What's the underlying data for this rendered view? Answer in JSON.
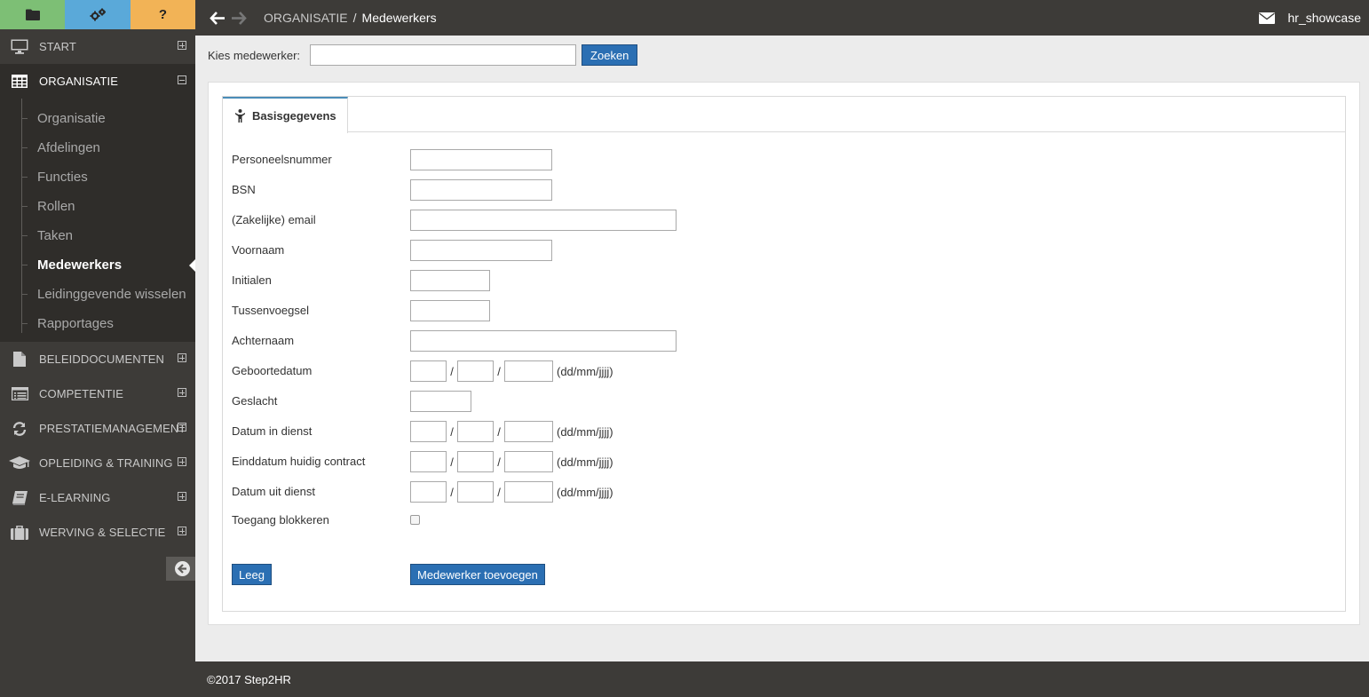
{
  "sidebar": {
    "tabs": [
      {
        "icon": "folder-icon"
      },
      {
        "icon": "gears-icon"
      },
      {
        "icon": "help-icon",
        "label": "?"
      }
    ],
    "sections": {
      "start": {
        "label": "START",
        "icon": "monitor-icon",
        "toggle": "expand"
      },
      "organisatie": {
        "label": "ORGANISATIE",
        "icon": "grid-icon",
        "toggle": "collapse"
      },
      "beleid": {
        "label": "BELEIDDOCUMENTEN",
        "icon": "document-icon",
        "toggle": "expand"
      },
      "competentie": {
        "label": "COMPETENTIE",
        "icon": "list-icon",
        "toggle": "expand"
      },
      "prestatie": {
        "label": "PRESTATIEMANAGEMENT",
        "icon": "refresh-icon",
        "toggle": "expand"
      },
      "opleiding": {
        "label": "OPLEIDING & TRAINING",
        "icon": "graduation-cap-icon",
        "toggle": "expand"
      },
      "elearning": {
        "label": "E-LEARNING",
        "icon": "book-icon",
        "toggle": "expand"
      },
      "werving": {
        "label": "WERVING & SELECTIE",
        "icon": "briefcase-icon",
        "toggle": "expand"
      }
    },
    "sub_items": [
      {
        "label": "Organisatie"
      },
      {
        "label": "Afdelingen"
      },
      {
        "label": "Functies"
      },
      {
        "label": "Rollen"
      },
      {
        "label": "Taken"
      },
      {
        "label": "Medewerkers",
        "active": true
      },
      {
        "label": "Leidinggevende wisselen"
      },
      {
        "label": "Rapportages"
      }
    ],
    "collapse_icon": "arrow-circle-left-icon"
  },
  "topbar": {
    "breadcrumb_parent": "ORGANISATIE",
    "breadcrumb_separator": "/",
    "breadcrumb_current": "Medewerkers",
    "user": "hr_showcase"
  },
  "search": {
    "label": "Kies medewerker:",
    "value": "",
    "button": "Zoeken"
  },
  "form": {
    "tab_label": "Basisgegevens",
    "fields": {
      "personeelsnummer": "Personeelsnummer",
      "bsn": "BSN",
      "email": "(Zakelijke) email",
      "voornaam": "Voornaam",
      "initialen": "Initialen",
      "tussenvoegsel": "Tussenvoegsel",
      "achternaam": "Achternaam",
      "geboortedatum": "Geboortedatum",
      "geslacht": "Geslacht",
      "datum_in_dienst": "Datum in dienst",
      "einddatum": "Einddatum huidig contract",
      "datum_uit_dienst": "Datum uit dienst",
      "toegang": "Toegang blokkeren"
    },
    "date_separator": "/",
    "date_hint": "(dd/mm/jjjj)",
    "block_access_checked": false,
    "button_clear": "Leeg",
    "button_add": "Medewerker toevoegen"
  },
  "footer": {
    "copyright": "©2017 Step2HR"
  },
  "colors": {
    "sidebar_bg": "#3d3b38",
    "tab_green": "#7dbf75",
    "tab_blue": "#5aa9d9",
    "tab_orange": "#f2b356",
    "button_blue": "#2b6fb3",
    "tab_border_accent": "#4a8cb8"
  }
}
